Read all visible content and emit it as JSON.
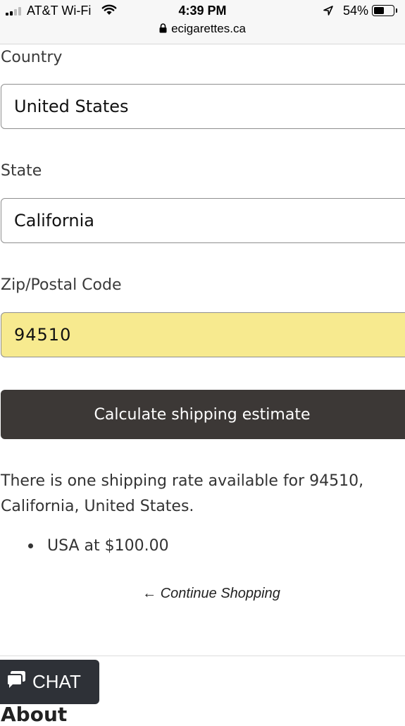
{
  "status_bar": {
    "carrier": "AT&T Wi-Fi",
    "time": "4:39 PM",
    "battery": "54%",
    "battery_level": 0.54,
    "url": "ecigarettes.ca"
  },
  "form": {
    "country_label": "Country",
    "country_value": "United States",
    "state_label": "State",
    "state_value": "California",
    "zip_label": "Zip/Postal Code",
    "zip_value": "94510",
    "calculate_label": "Calculate shipping estimate"
  },
  "results": {
    "message": "There is one shipping rate available for 94510, California, United States.",
    "rates": [
      "USA at $100.00"
    ]
  },
  "continue_label": "← Continue Shopping",
  "chat_label": "CHAT",
  "footer_heading": "About"
}
